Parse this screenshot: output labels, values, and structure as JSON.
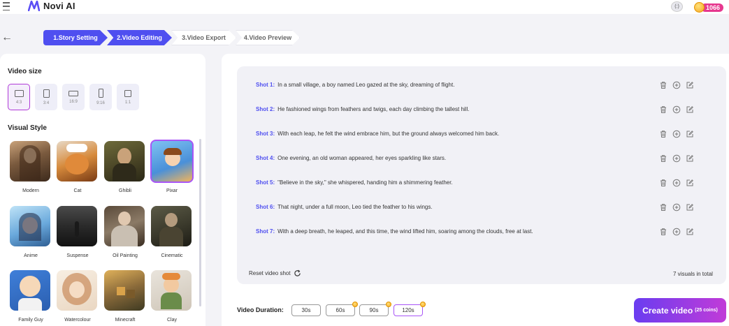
{
  "app": {
    "name": "Novi AI",
    "coin_balance": "1066",
    "avatar_text": "(:)"
  },
  "steps": [
    {
      "label": "1.Story Setting",
      "active": true
    },
    {
      "label": "2.Video Editing",
      "active": true
    },
    {
      "label": "3.Video Export",
      "active": false
    },
    {
      "label": "4.Video Preview",
      "active": false
    }
  ],
  "video_size": {
    "title": "Video size",
    "options": [
      "4:3",
      "3:4",
      "16:9",
      "9:16",
      "1:1"
    ],
    "selected": "4:3"
  },
  "visual_style": {
    "title": "Visual Style",
    "styles": [
      "Modern",
      "Cat",
      "Ghibli",
      "Pixar",
      "Anime",
      "Suspense",
      "Oil Painting",
      "Cinematic",
      "Family Guy",
      "Watercolour",
      "Minecraft",
      "Clay"
    ],
    "selected": "Pixar"
  },
  "shots": [
    {
      "label": "Shot 1:",
      "text": "In a small village, a boy named Leo gazed at the sky, dreaming of flight."
    },
    {
      "label": "Shot 2:",
      "text": "He fashioned wings from feathers and twigs, each day climbing the tallest hill."
    },
    {
      "label": "Shot 3:",
      "text": "With each leap, he felt the wind embrace him, but the ground always welcomed him back."
    },
    {
      "label": "Shot 4:",
      "text": "One evening, an old woman appeared, her eyes sparkling like stars."
    },
    {
      "label": "Shot 5:",
      "text": "\"Believe in the sky,\" she whispered, handing him a shimmering feather."
    },
    {
      "label": "Shot 6:",
      "text": "That night, under a full moon, Leo tied the feather to his wings."
    },
    {
      "label": "Shot 7:",
      "text": "With a deep breath, he leaped, and this time, the wind lifted him, soaring among the clouds, free at last."
    }
  ],
  "reset_label": "Reset video shot",
  "total_label": "7 visuals in total",
  "duration": {
    "label": "Video Duration:",
    "options": [
      "30s",
      "60s",
      "90s",
      "120s"
    ],
    "selected": "120s"
  },
  "create": {
    "label": "Create video",
    "cost": "(25 coins)"
  },
  "colors": {
    "accent": "#4f4ff0",
    "select": "#a855f7",
    "badge": "#e6388f"
  }
}
